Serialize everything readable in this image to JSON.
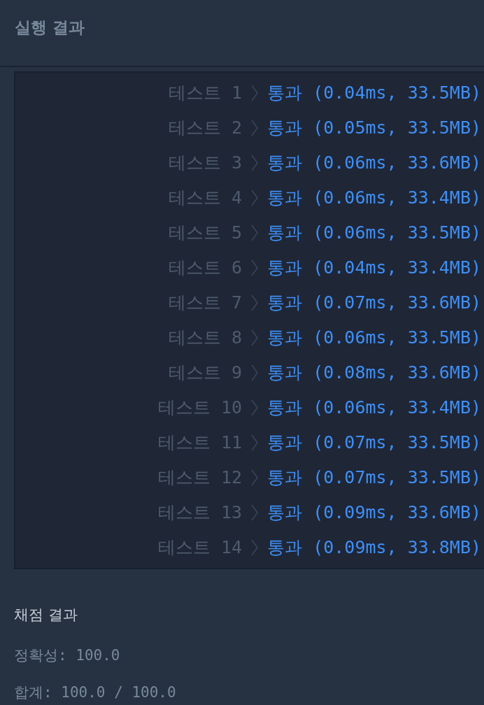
{
  "run_results": {
    "title": "실행 결과",
    "tests": [
      {
        "label": "테스트 1",
        "result": "통과 (0.04ms, 33.5MB)",
        "passed": true
      },
      {
        "label": "테스트 2",
        "result": "통과 (0.05ms, 33.5MB)",
        "passed": true
      },
      {
        "label": "테스트 3",
        "result": "통과 (0.06ms, 33.6MB)",
        "passed": true
      },
      {
        "label": "테스트 4",
        "result": "통과 (0.06ms, 33.4MB)",
        "passed": true
      },
      {
        "label": "테스트 5",
        "result": "통과 (0.06ms, 33.5MB)",
        "passed": true
      },
      {
        "label": "테스트 6",
        "result": "통과 (0.04ms, 33.4MB)",
        "passed": true
      },
      {
        "label": "테스트 7",
        "result": "통과 (0.07ms, 33.6MB)",
        "passed": true
      },
      {
        "label": "테스트 8",
        "result": "통과 (0.06ms, 33.5MB)",
        "passed": true
      },
      {
        "label": "테스트 9",
        "result": "통과 (0.08ms, 33.6MB)",
        "passed": true
      },
      {
        "label": "테스트 10",
        "result": "통과 (0.06ms, 33.4MB)",
        "passed": true
      },
      {
        "label": "테스트 11",
        "result": "통과 (0.07ms, 33.5MB)",
        "passed": true
      },
      {
        "label": "테스트 12",
        "result": "통과 (0.07ms, 33.5MB)",
        "passed": true
      },
      {
        "label": "테스트 13",
        "result": "통과 (0.09ms, 33.6MB)",
        "passed": true
      },
      {
        "label": "테스트 14",
        "result": "통과 (0.09ms, 33.8MB)",
        "passed": true
      }
    ]
  },
  "grading": {
    "title": "채점 결과",
    "lines": [
      "정확성: 100.0",
      "합계: 100.0 / 100.0"
    ]
  }
}
